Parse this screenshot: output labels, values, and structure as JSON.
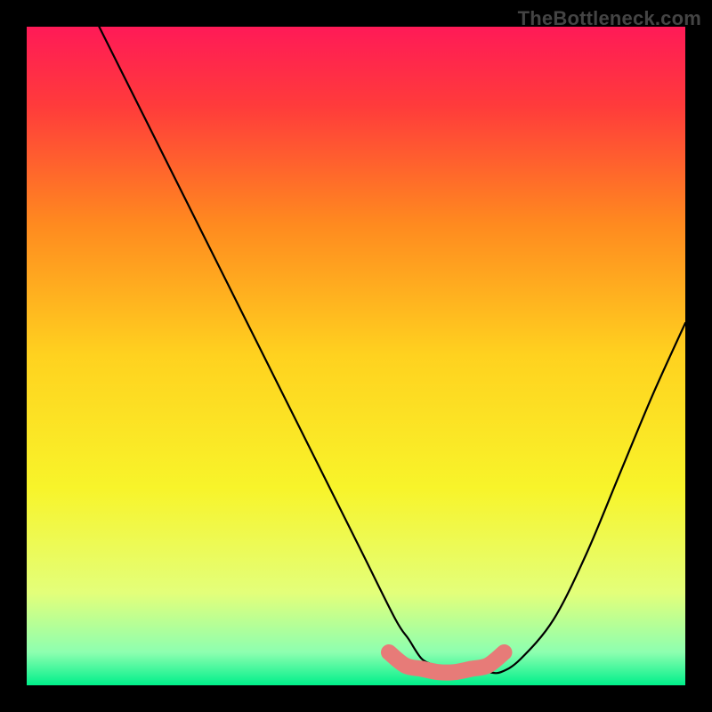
{
  "watermark": "TheBottleneck.com",
  "colors": {
    "background": "#000000",
    "gradient_stops": [
      {
        "offset": 0.0,
        "color": "#ff1a57"
      },
      {
        "offset": 0.12,
        "color": "#ff3b3b"
      },
      {
        "offset": 0.3,
        "color": "#ff8a1f"
      },
      {
        "offset": 0.5,
        "color": "#ffd21f"
      },
      {
        "offset": 0.7,
        "color": "#f8f42a"
      },
      {
        "offset": 0.86,
        "color": "#e3ff7a"
      },
      {
        "offset": 0.95,
        "color": "#8dffb0"
      },
      {
        "offset": 1.0,
        "color": "#00ef8a"
      }
    ],
    "curve": "#000000",
    "blob": "#e77b78"
  },
  "chart_data": {
    "type": "line",
    "title": "",
    "xlabel": "",
    "ylabel": "",
    "xlim": [
      0,
      100
    ],
    "ylim": [
      0,
      100
    ],
    "grid": false,
    "legend": false,
    "series": [
      {
        "name": "curve",
        "x": [
          11,
          16,
          21,
          26,
          31,
          36,
          41,
          46,
          51,
          56,
          58,
          60,
          62,
          64,
          66,
          68,
          70,
          72,
          75,
          80,
          85,
          90,
          95,
          100
        ],
        "y": [
          100,
          90,
          80,
          70,
          60,
          50,
          40,
          30,
          20,
          10,
          7,
          4,
          3,
          2,
          2,
          2,
          2,
          2,
          4,
          10,
          20,
          32,
          44,
          55
        ]
      },
      {
        "name": "blob",
        "x": [
          55,
          57.5,
          60,
          62.5,
          65,
          67.5,
          70,
          72.5
        ],
        "y": [
          5,
          3,
          2.5,
          2,
          2,
          2.5,
          3,
          5
        ]
      }
    ]
  }
}
